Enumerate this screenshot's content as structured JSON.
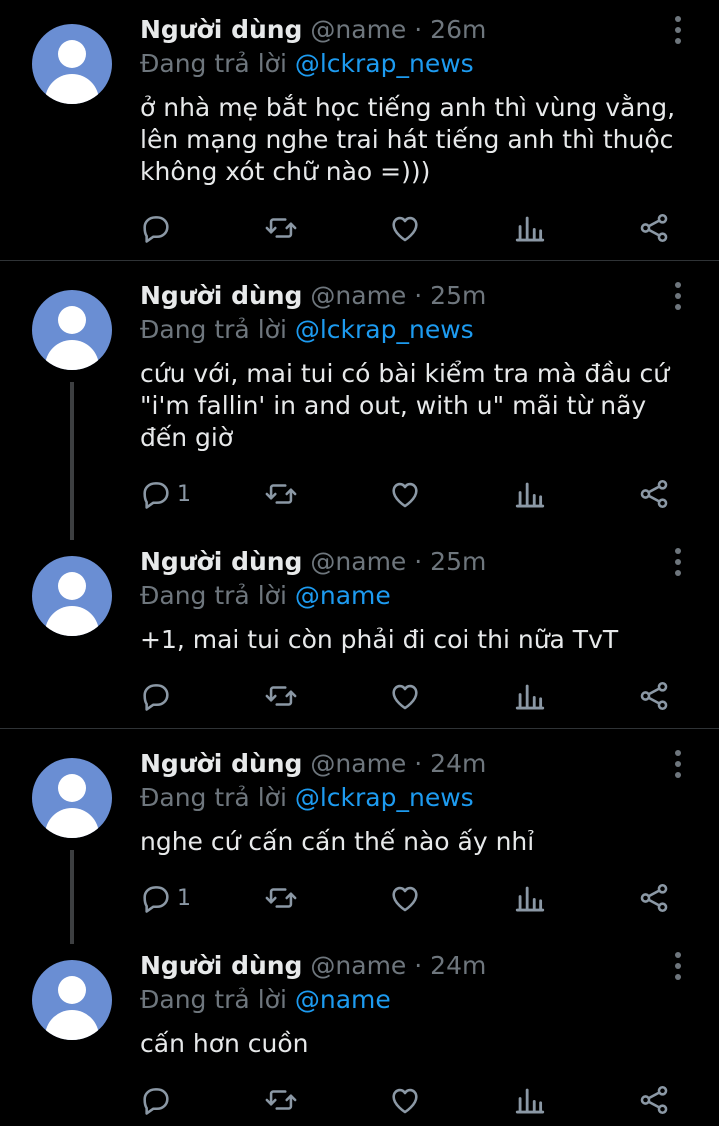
{
  "tweets": [
    {
      "name": "Người dùng",
      "handle": "@name",
      "time": "26m",
      "separator": "·",
      "reply_label": "Đang trả lời",
      "reply_to": "@lckrap_news",
      "text": "ở nhà mẹ bắt học tiếng anh thì vùng vằng, lên mạng nghe trai hát tiếng anh thì thuộc không xót chữ nào =)))",
      "reply_count": ""
    },
    {
      "name": "Người dùng",
      "handle": "@name",
      "time": "25m",
      "separator": "·",
      "reply_label": "Đang trả lời",
      "reply_to": "@lckrap_news",
      "text": "cứu với, mai tui có bài kiểm tra mà đầu cứ \"i'm fallin' in and out, with u\" mãi từ nãy đến giờ",
      "reply_count": "1"
    },
    {
      "name": "Người dùng",
      "handle": "@name",
      "time": "25m",
      "separator": "·",
      "reply_label": "Đang trả lời",
      "reply_to": "@name",
      "text": "+1, mai tui còn phải đi coi thi nữa TvT",
      "reply_count": ""
    },
    {
      "name": "Người dùng",
      "handle": "@name",
      "time": "24m",
      "separator": "·",
      "reply_label": "Đang trả lời",
      "reply_to": "@lckrap_news",
      "text": "nghe cứ cấn cấn thế nào ấy nhỉ",
      "reply_count": "1"
    },
    {
      "name": "Người dùng",
      "handle": "@name",
      "time": "24m",
      "separator": "·",
      "reply_label": "Đang trả lời",
      "reply_to": "@name",
      "text": "cấn hơn cuồn",
      "reply_count": ""
    }
  ],
  "colors": {
    "background": "#000000",
    "mention": "#1d9bf0",
    "muted": "#6e767d",
    "avatar": "#6a8ed3"
  },
  "icons": [
    "reply-icon",
    "retweet-icon",
    "like-icon",
    "views-icon",
    "share-icon",
    "more-options-icon",
    "default-avatar"
  ]
}
